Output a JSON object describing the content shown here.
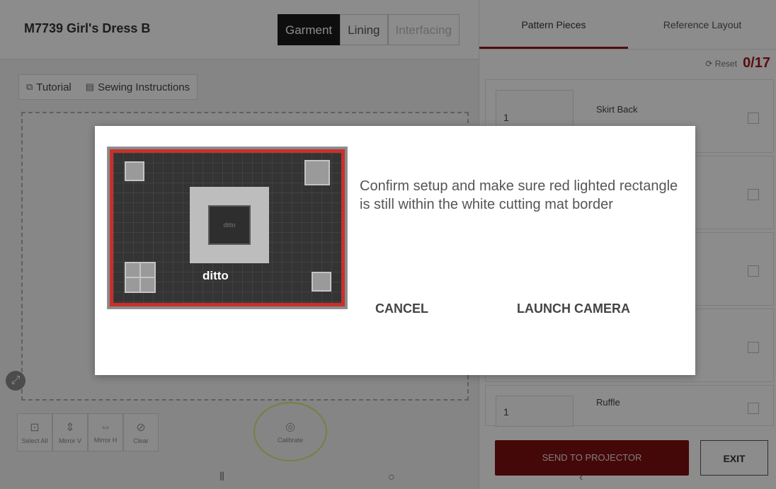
{
  "app": {
    "project_title": "M7739 Girl's Dress B",
    "view_tabs": [
      {
        "label": "Garment",
        "active": true
      },
      {
        "label": "Lining",
        "active": false
      },
      {
        "label": "Interfacing",
        "active": false,
        "disabled": true
      }
    ]
  },
  "help": {
    "tutorial": "Tutorial",
    "tutorial_icon": "tutorial-icon",
    "sewing": "Sewing Instructions",
    "sewing_icon": "book-icon"
  },
  "tools": [
    {
      "label": "Select All",
      "icon": "select-all-icon"
    },
    {
      "label": "Mirror V",
      "icon": "mirror-v-icon"
    },
    {
      "label": "Mirror H",
      "icon": "mirror-h-icon"
    },
    {
      "label": "Clear",
      "icon": "clear-icon"
    }
  ],
  "calibrate": {
    "label": "Calibrate",
    "icon": "calibrate-icon"
  },
  "right": {
    "tabs": [
      {
        "label": "Pattern Pieces",
        "active": true
      },
      {
        "label": "Reference Layout",
        "active": false
      }
    ],
    "reset_label": "⟳ Reset",
    "counter": "0/17",
    "pieces": [
      {
        "qty": "1",
        "name": "Skirt Back"
      },
      {
        "qty": "",
        "name": ""
      },
      {
        "qty": "",
        "name": ""
      },
      {
        "qty": "",
        "name": ""
      },
      {
        "qty": "1",
        "name": "Ruffle"
      }
    ],
    "send_label": "SEND TO PROJECTOR",
    "exit_label": "EXIT"
  },
  "dialog": {
    "message": "Confirm setup and make sure red lighted rectangle is still within the white cutting mat border",
    "cancel": "CANCEL",
    "launch": "LAUNCH CAMERA",
    "mat_logo": "ditto",
    "mat_center_text": "ditto",
    "accent_color": "#c8302c"
  },
  "colors": {
    "brand_red": "#7c0f0f",
    "counter_red": "#a01818",
    "calibrate_highlight": "#d7ea7a"
  }
}
